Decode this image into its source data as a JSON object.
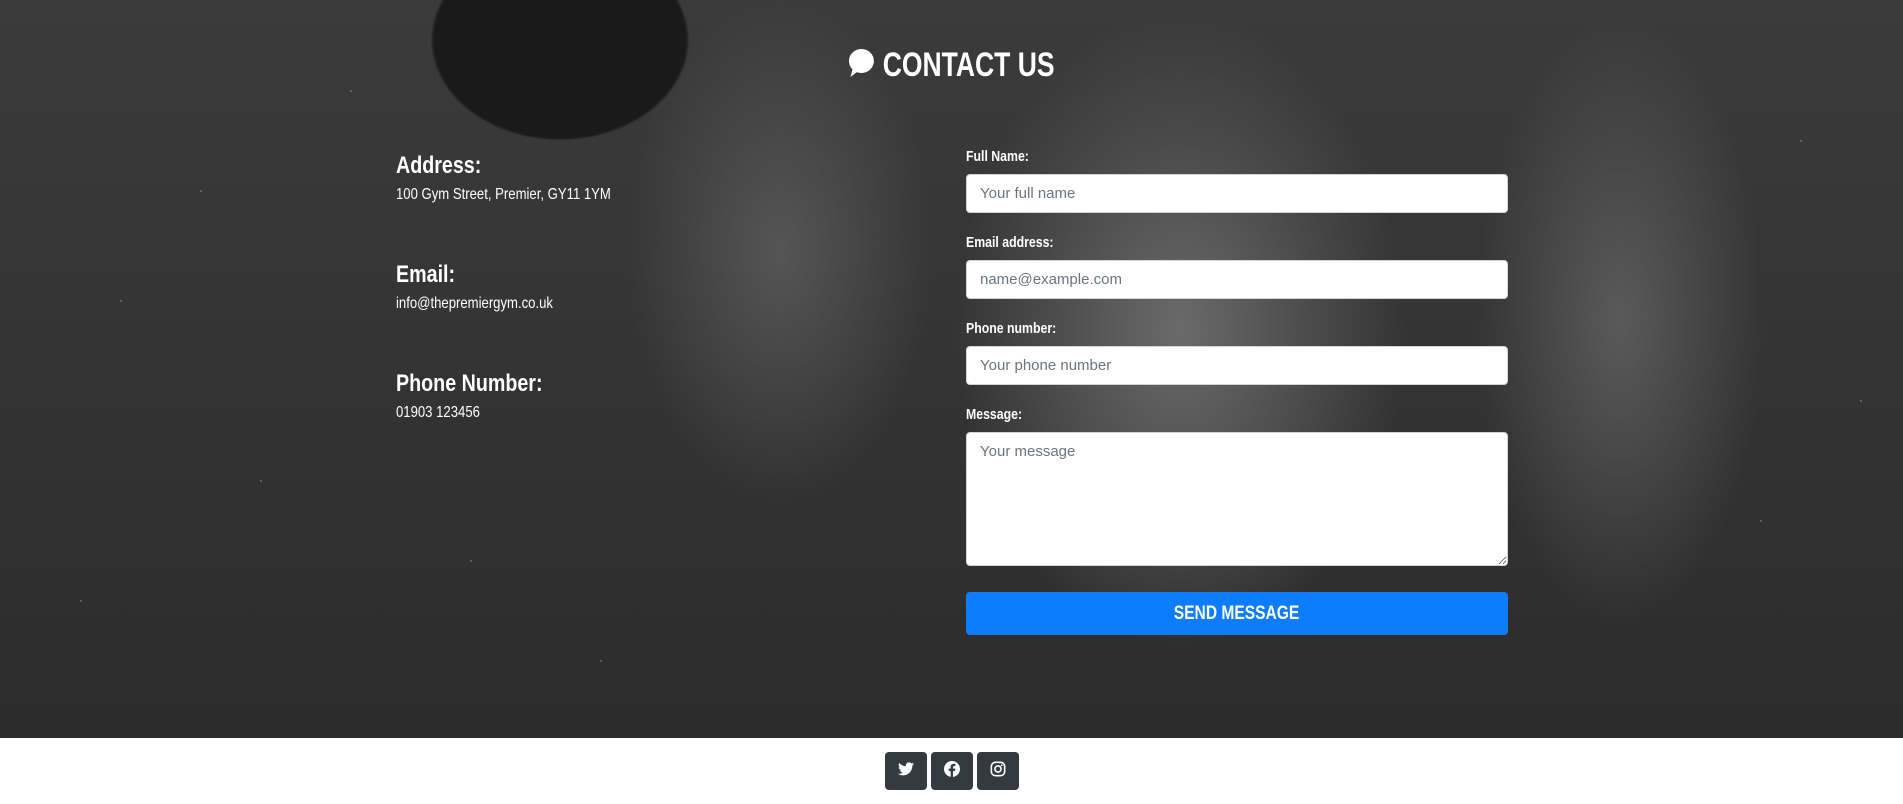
{
  "header": {
    "title": "CONTACT US",
    "icon": "chat-bubble-icon"
  },
  "contact_info": {
    "address": {
      "heading": "Address:",
      "value": "100 Gym Street, Premier, GY11 1YM"
    },
    "email": {
      "heading": "Email:",
      "value": "info@thepremiergym.co.uk"
    },
    "phone": {
      "heading": "Phone Number:",
      "value": "01903 123456"
    }
  },
  "form": {
    "full_name": {
      "label": "Full Name:",
      "placeholder": "Your full name"
    },
    "email": {
      "label": "Email address:",
      "placeholder": "name@example.com"
    },
    "phone": {
      "label": "Phone number:",
      "placeholder": "Your phone number"
    },
    "message": {
      "label": "Message:",
      "placeholder": "Your message"
    },
    "submit_label": "SEND MESSAGE"
  },
  "footer": {
    "social": [
      {
        "icon": "twitter-icon"
      },
      {
        "icon": "facebook-icon"
      },
      {
        "icon": "instagram-icon"
      }
    ]
  },
  "colors": {
    "accent": "#0d7dfd",
    "social_button": "#343a40",
    "hero_dark": "#2c2c2c"
  }
}
